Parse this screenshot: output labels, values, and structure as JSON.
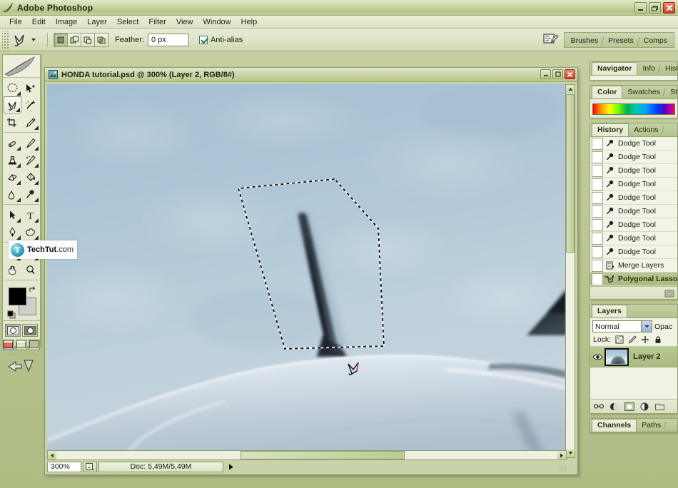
{
  "app": {
    "title": "Adobe Photoshop",
    "icon": "photoshop-icon",
    "window_controls": {
      "minimize": "_",
      "restore": "□",
      "close": "✕"
    }
  },
  "menubar": {
    "items": [
      "File",
      "Edit",
      "Image",
      "Layer",
      "Select",
      "Filter",
      "View",
      "Window",
      "Help"
    ]
  },
  "options_bar": {
    "tool_icon": "polygonal-lasso-icon",
    "tool_preset_caret": "▾",
    "selection_modes": [
      "new-selection",
      "add-to-selection",
      "subtract-from-selection",
      "intersect-with-selection"
    ],
    "active_selection_mode": "new-selection",
    "feather_label": "Feather:",
    "feather_value": "0 px",
    "antialias_label": "Anti-alias",
    "antialias_checked": true,
    "palette_well": {
      "dock_icon": "palette-dock-icon",
      "tabs": [
        "Brushes",
        "Presets",
        "Comps"
      ]
    }
  },
  "toolbox": {
    "header_icon": "feather-banner-icon",
    "tools": [
      {
        "name": "marquee-tool",
        "glyph": "○",
        "has_flyout": true,
        "selected": false
      },
      {
        "name": "move-tool",
        "glyph": "✣",
        "has_flyout": false,
        "selected": false
      },
      {
        "name": "lasso-tool",
        "glyph": "✈",
        "has_flyout": true,
        "selected": true
      },
      {
        "name": "magic-wand-tool",
        "glyph": "✶",
        "has_flyout": false,
        "selected": false
      },
      {
        "name": "crop-tool",
        "glyph": "⧉",
        "has_flyout": false,
        "selected": false
      },
      {
        "name": "slice-tool",
        "glyph": "✂",
        "has_flyout": true,
        "selected": false
      },
      {
        "name": "healing-brush-tool",
        "glyph": "✎",
        "has_flyout": true,
        "selected": false
      },
      {
        "name": "brush-tool",
        "glyph": "✐",
        "has_flyout": true,
        "selected": false
      },
      {
        "name": "clone-stamp-tool",
        "glyph": "⚑",
        "has_flyout": true,
        "selected": false
      },
      {
        "name": "history-brush-tool",
        "glyph": "✒",
        "has_flyout": true,
        "selected": false
      },
      {
        "name": "eraser-tool",
        "glyph": "▱",
        "has_flyout": true,
        "selected": false
      },
      {
        "name": "paint-bucket-tool",
        "glyph": "◇",
        "has_flyout": true,
        "selected": false
      },
      {
        "name": "blur-tool",
        "glyph": "◖",
        "has_flyout": true,
        "selected": false
      },
      {
        "name": "dodge-tool",
        "glyph": "⚲",
        "has_flyout": true,
        "selected": false
      },
      {
        "name": "path-selection-tool",
        "glyph": "▶",
        "has_flyout": true,
        "selected": false
      },
      {
        "name": "type-tool",
        "glyph": "T",
        "has_flyout": true,
        "selected": false
      },
      {
        "name": "pen-tool",
        "glyph": "✑",
        "has_flyout": true,
        "selected": false
      },
      {
        "name": "custom-shape-tool",
        "glyph": "⬟",
        "has_flyout": true,
        "selected": false
      },
      {
        "name": "notes-tool",
        "glyph": "☰",
        "has_flyout": true,
        "selected": false
      },
      {
        "name": "eyedropper-tool",
        "glyph": "⚗",
        "has_flyout": true,
        "selected": false
      },
      {
        "name": "hand-tool",
        "glyph": "✋",
        "has_flyout": false,
        "selected": false
      },
      {
        "name": "zoom-tool",
        "glyph": "⚲",
        "has_flyout": false,
        "selected": false
      }
    ],
    "foreground_color": "#000000",
    "background_color": "#cfd0cb",
    "mask_modes": [
      "standard-mask-mode",
      "quick-mask-mode"
    ],
    "active_mask_mode": "standard-mask-mode",
    "screen_modes": [
      "standard-screen-mode",
      "full-screen-with-menubar",
      "full-screen-mode"
    ],
    "active_screen_mode": "standard-screen-mode",
    "jump_to_imageready": "jump-to-imageready-icon"
  },
  "watermark": {
    "logo": "techtut-logo-icon",
    "brand": "TechTut",
    "tld": ".com"
  },
  "document": {
    "icon": "psd-document-icon",
    "title": "HONDA tutorial.psd @ 300% (Layer 2, RGB/8#)",
    "window_controls": {
      "minimize": "_",
      "maximize": "□",
      "close": "✕"
    },
    "status": {
      "zoom": "300%",
      "zoom_icon": "doc-thumb-icon",
      "doc_size": "Doc: 5,49M/5,49M",
      "play_icon": "▶"
    },
    "scrollbars": {
      "vertical": {
        "up": "▲",
        "down": "▼"
      },
      "horizontal": {
        "left": "◀",
        "right": "▶"
      }
    },
    "canvas": {
      "description": "blurred sky-blue photo of a car roof with antenna and wing mirror",
      "sky_top": "#a9c2d4",
      "sky_bottom": "#c3d2dd",
      "car_body": "#d3dce4",
      "antenna_color": "#1b2228",
      "selection_type": "polygonal-lasso-marching-ants",
      "cursor": "polygonal-lasso-cursor"
    }
  },
  "palettes": {
    "navigator_group": {
      "tabs": [
        {
          "label": "Navigator",
          "active": true
        },
        {
          "label": "Info",
          "active": false
        },
        {
          "label": "Histog",
          "active": false
        }
      ]
    },
    "color_group": {
      "tabs": [
        {
          "label": "Color",
          "active": true
        },
        {
          "label": "Swatches",
          "active": false
        },
        {
          "label": "Styles",
          "active": false
        }
      ],
      "ramp": "color-spectrum-ramp"
    },
    "history_group": {
      "tabs": [
        {
          "label": "History",
          "active": true
        },
        {
          "label": "Actions",
          "active": false
        }
      ],
      "items": [
        {
          "label": "Dodge Tool",
          "icon": "dodge-tool-icon",
          "selected": false
        },
        {
          "label": "Dodge Tool",
          "icon": "dodge-tool-icon",
          "selected": false
        },
        {
          "label": "Dodge Tool",
          "icon": "dodge-tool-icon",
          "selected": false
        },
        {
          "label": "Dodge Tool",
          "icon": "dodge-tool-icon",
          "selected": false
        },
        {
          "label": "Dodge Tool",
          "icon": "dodge-tool-icon",
          "selected": false
        },
        {
          "label": "Dodge Tool",
          "icon": "dodge-tool-icon",
          "selected": false
        },
        {
          "label": "Dodge Tool",
          "icon": "dodge-tool-icon",
          "selected": false
        },
        {
          "label": "Dodge Tool",
          "icon": "dodge-tool-icon",
          "selected": false
        },
        {
          "label": "Dodge Tool",
          "icon": "dodge-tool-icon",
          "selected": false
        },
        {
          "label": "Merge Layers",
          "icon": "merge-layers-icon",
          "selected": false
        },
        {
          "label": "Polygonal Lasso",
          "icon": "polygonal-lasso-icon",
          "selected": true
        }
      ],
      "footer_buttons": [
        "create-new-document-from-state",
        "create-new-snapshot",
        "delete-state"
      ]
    },
    "layers_group": {
      "tabs": [
        {
          "label": "Layers",
          "active": true
        }
      ],
      "blend_mode": "Normal",
      "blend_mode_caret": "▾",
      "opacity_label": "Opac",
      "lock_label": "Lock:",
      "lock_icons": [
        "lock-transparent-pixels-icon",
        "lock-image-pixels-icon",
        "lock-position-icon",
        "lock-all-icon"
      ],
      "layers": [
        {
          "name": "Layer 2",
          "visible": true,
          "selected": true,
          "eye_icon": "eye-icon",
          "thumbnail": "layer-thumbnail"
        }
      ],
      "footer_buttons": [
        "link-layers-icon",
        "layer-style-icon",
        "add-layer-mask-icon",
        "new-fill-adjustment-icon",
        "new-group-icon"
      ]
    },
    "channels_group": {
      "tabs": [
        {
          "label": "Channels",
          "active": true
        },
        {
          "label": "Paths",
          "active": false
        }
      ]
    }
  }
}
